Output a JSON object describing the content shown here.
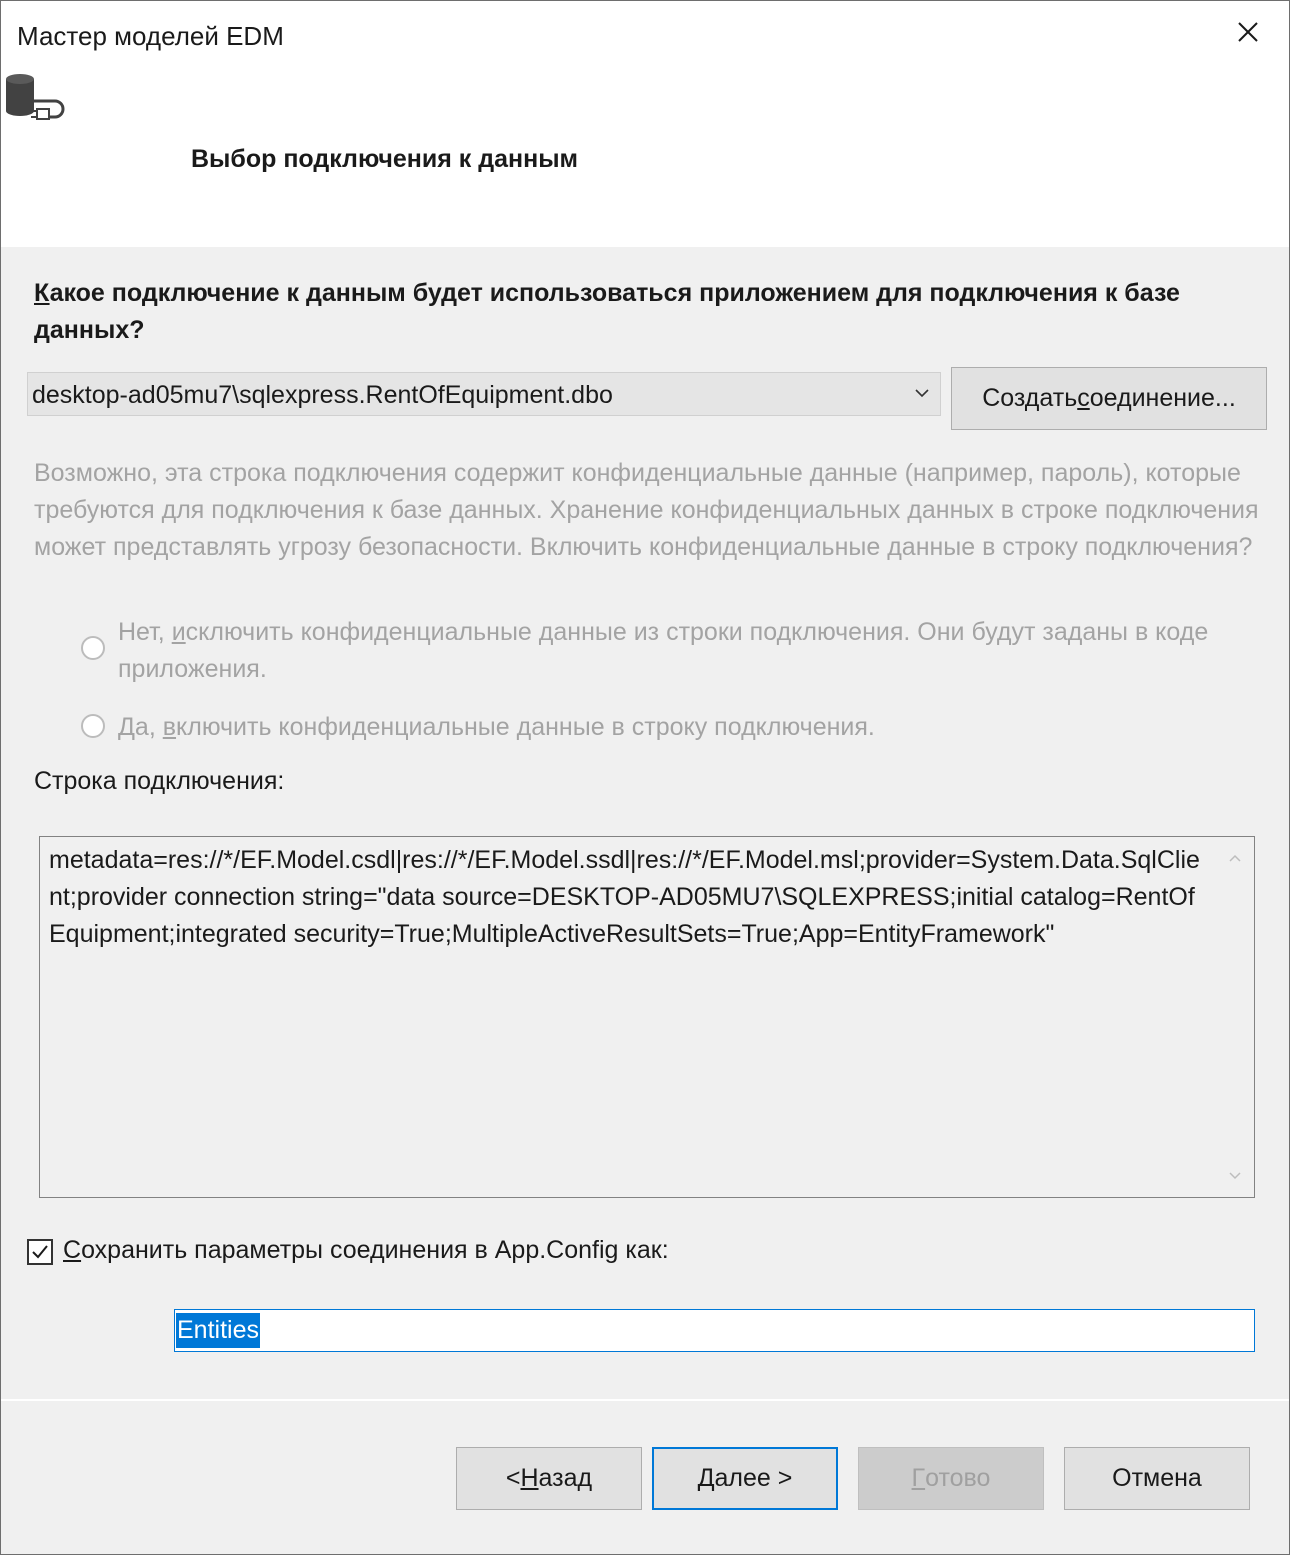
{
  "window": {
    "title": "Мастер моделей EDM"
  },
  "header": {
    "page_title": "Выбор подключения к данным"
  },
  "question": {
    "access_key": "К",
    "text_rest": "акое подключение к данным будет использоваться приложением для подключения к базе данных?"
  },
  "connection_select": {
    "selected": "desktop-ad05mu7\\sqlexpress.RentOfEquipment.dbo"
  },
  "create_connection_button": {
    "pre": "Создать ",
    "access_key": "с",
    "post": "оединение..."
  },
  "warning_text": "Возможно, эта строка подключения содержит конфиденциальные данные (например, пароль), которые требуются для подключения к базе данных. Хранение конфиденциальных данных в строке подключения может представлять угрозу безопасности. Включить конфиденциальные данные в строку подключения?",
  "radio_no": {
    "pre": "Нет, ",
    "access_key": "и",
    "post": "сключить конфиденциальные данные из строки подключения. Они будут заданы в коде приложения."
  },
  "radio_yes": {
    "pre": "Да, ",
    "access_key": "в",
    "post": "ключить конфиденциальные данные в строку подключения."
  },
  "connection_string": {
    "label": "Строка подключения:",
    "value": "metadata=res://*/EF.Model.csdl|res://*/EF.Model.ssdl|res://*/EF.Model.msl;provider=System.Data.SqlClient;provider connection string=\"data source=DESKTOP-AD05MU7\\SQLEXPRESS;initial catalog=RentOfEquipment;integrated security=True;MultipleActiveResultSets=True;App=EntityFramework\""
  },
  "save_settings": {
    "checked": true,
    "access_key": "С",
    "text_rest": "охранить параметры соединения в App.Config как:"
  },
  "entity_name_input": {
    "value": "Entities"
  },
  "buttons": {
    "back": {
      "pre": "< ",
      "access_key": "Н",
      "post": "азад"
    },
    "next": {
      "access_key": "Д",
      "post": "алее >"
    },
    "finish": {
      "access_key": "Г",
      "post": "отово",
      "enabled": false
    },
    "cancel": {
      "label": "Отмена"
    }
  },
  "colors": {
    "accent": "#0078d7",
    "disabled_text": "#a3a3a3",
    "dialog_bg": "#f0f0f0"
  },
  "icons": [
    "close-icon",
    "database-connection-icon",
    "chevron-down-icon",
    "checkmark-icon",
    "scroll-up-icon",
    "scroll-down-icon"
  ]
}
